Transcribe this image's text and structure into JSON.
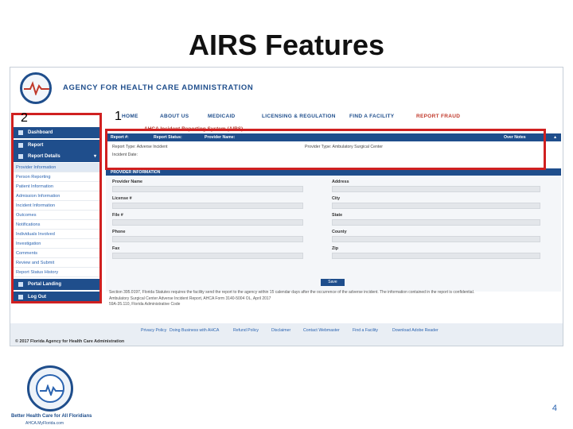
{
  "slide": {
    "title": "AIRS Features",
    "page_number": "4"
  },
  "header": {
    "agency_name": "AGENCY FOR HEALTH CARE ADMINISTRATION"
  },
  "top_nav": [
    {
      "label": "HOME"
    },
    {
      "label": "ABOUT US"
    },
    {
      "label": "MEDICAID"
    },
    {
      "label": "LICENSING & REGULATION"
    },
    {
      "label": "FIND A FACILITY"
    },
    {
      "label": "REPORT FRAUD"
    }
  ],
  "system_title": "AHCA Incident Reporting System (AIRS)",
  "sidebar": {
    "dashboard": "Dashboard",
    "report": "Report",
    "report_details": "Report Details",
    "links": [
      "Provider Information",
      "Person Reporting",
      "Patient Information",
      "Admission Information",
      "Incident Information",
      "Outcomes",
      "Notifications",
      "Individuals Involved",
      "Investigation",
      "Comments",
      "Review and Submit",
      "Report Status History"
    ],
    "portal_landing": "Portal Landing",
    "log_out": "Log Out"
  },
  "report_header": {
    "report_no_label": "Report #:",
    "report_status_label": "Report Status:",
    "provider_name_label": "Provider Name:",
    "right_label": "Over Notes"
  },
  "report_info": {
    "report_type": "Report Type: Adverse Incident",
    "incident_date": "Incident Date:",
    "provider_type": "Provider Type: Ambulatory Surgical Center"
  },
  "provider_section_title": "PROVIDER INFORMATION",
  "form_fields": {
    "provider_name": "Provider Name",
    "address": "Address",
    "license": "License #",
    "city": "City",
    "file": "File #",
    "state": "State",
    "phone": "Phone",
    "county": "County",
    "fax": "Fax",
    "zip": "Zip"
  },
  "save_button": "Save",
  "notice": [
    "Section 395.0197, Florida Statutes requires the facility send the report to the agency within 15 calendar days after the occurrence of the adverse incident. The information contained in the report is confidential.",
    "Ambulatory Surgical Center Adverse Incident Report, AHCA Form 3140-5004 OL, April 2017",
    "59A-35.110, Florida Administrative Code"
  ],
  "footer": {
    "links": [
      "Privacy Policy",
      "Doing Business with AHCA",
      "Refund Policy",
      "Disclaimer",
      "Contact Webmaster",
      "Find a Facility",
      "Download Adobe Reader"
    ],
    "copyright": "© 2017 Florida Agency for Health Care Administration"
  },
  "annotations": {
    "label_1": "1",
    "label_2": "2"
  },
  "branding": {
    "tagline": "Better Health Care for All Floridians",
    "subline": "AHCA.MyFlorida.com"
  },
  "colors": {
    "brand_blue": "#1f4e8c",
    "annotation_red": "#d02020",
    "link_blue": "#2a63b0"
  }
}
